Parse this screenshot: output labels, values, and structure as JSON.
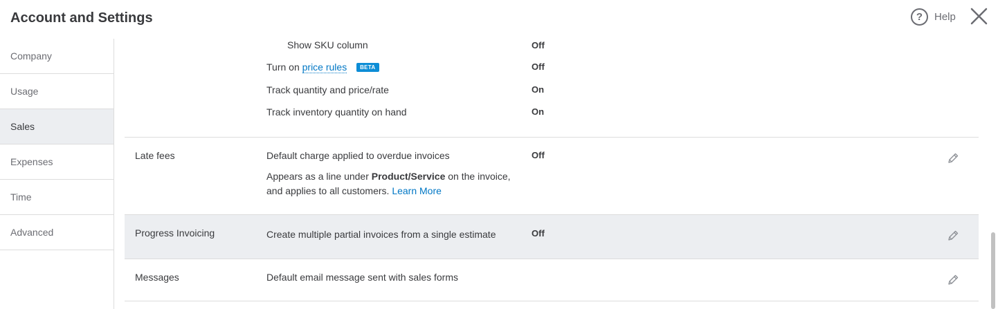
{
  "header": {
    "title": "Account and Settings",
    "help_label": "Help",
    "help_glyph": "?"
  },
  "sidebar": {
    "items": [
      {
        "label": "Company"
      },
      {
        "label": "Usage"
      },
      {
        "label": "Sales"
      },
      {
        "label": "Expenses"
      },
      {
        "label": "Time"
      },
      {
        "label": "Advanced"
      }
    ]
  },
  "products_services": {
    "show_sku_label": "Show SKU column",
    "show_sku_value": "Off",
    "price_rules_prefix": "Turn on",
    "price_rules_link": "price rules",
    "price_rules_badge": "BETA",
    "price_rules_value": "Off",
    "track_qty_label": "Track quantity and price/rate",
    "track_qty_value": "On",
    "track_inventory_label": "Track inventory quantity on hand",
    "track_inventory_value": "On"
  },
  "late_fees": {
    "label": "Late fees",
    "setting": "Default charge applied to overdue invoices",
    "value": "Off",
    "note_line1_prefix": "Appears as a line under",
    "note_line1_bold": "Product/Service",
    "note_line1_suffix": "on the invoice,",
    "note_line2": "and applies to all customers.",
    "learn_more": "Learn More"
  },
  "progress_invoicing": {
    "label": "Progress Invoicing",
    "setting": "Create multiple partial invoices from a single estimate",
    "value": "Off"
  },
  "messages": {
    "label": "Messages",
    "setting": "Default email message sent with sales forms"
  },
  "colors": {
    "link": "#0077c5",
    "badge": "#0d8dd6",
    "active_bg": "#eceef1"
  }
}
